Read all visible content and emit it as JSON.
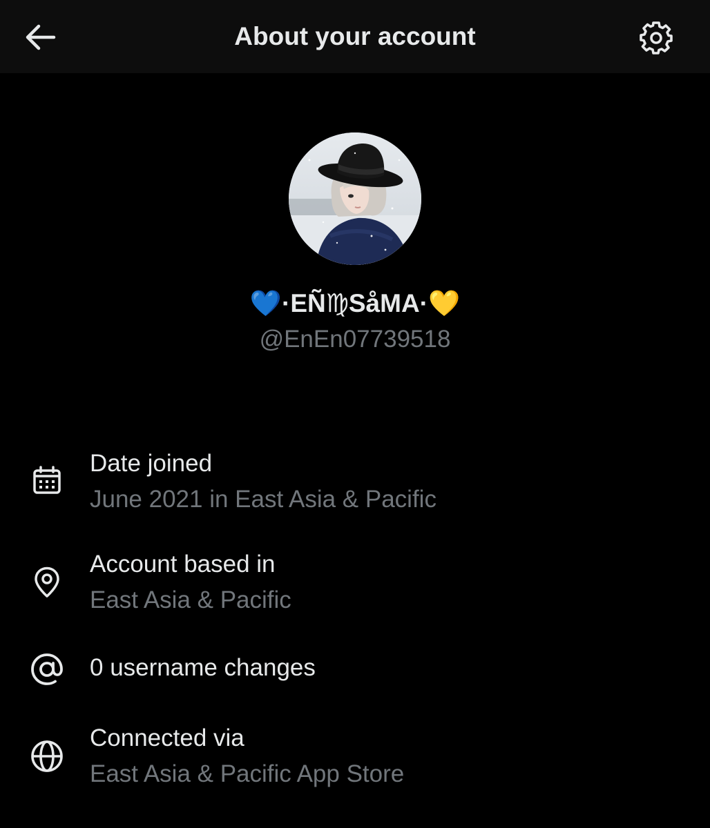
{
  "header": {
    "title": "About your account",
    "back_icon": "arrow-left-icon",
    "settings_icon": "gear-icon"
  },
  "profile": {
    "display_name": "💙·EÑ♍SåMA·💛",
    "handle": "@EnEn07739518"
  },
  "details": [
    {
      "icon": "calendar-icon",
      "title": "Date joined",
      "value": "June 2021 in East Asia & Pacific"
    },
    {
      "icon": "location-pin-icon",
      "title": "Account based in",
      "value": "East Asia & Pacific"
    },
    {
      "icon": "at-sign-icon",
      "title": "0 username changes"
    },
    {
      "icon": "globe-icon",
      "title": "Connected via",
      "value": "East Asia & Pacific App Store"
    }
  ],
  "colors": {
    "background": "#000000",
    "header_background": "#0d0d0d",
    "primary_text": "#e7e9ea",
    "secondary_text": "#71767b"
  }
}
